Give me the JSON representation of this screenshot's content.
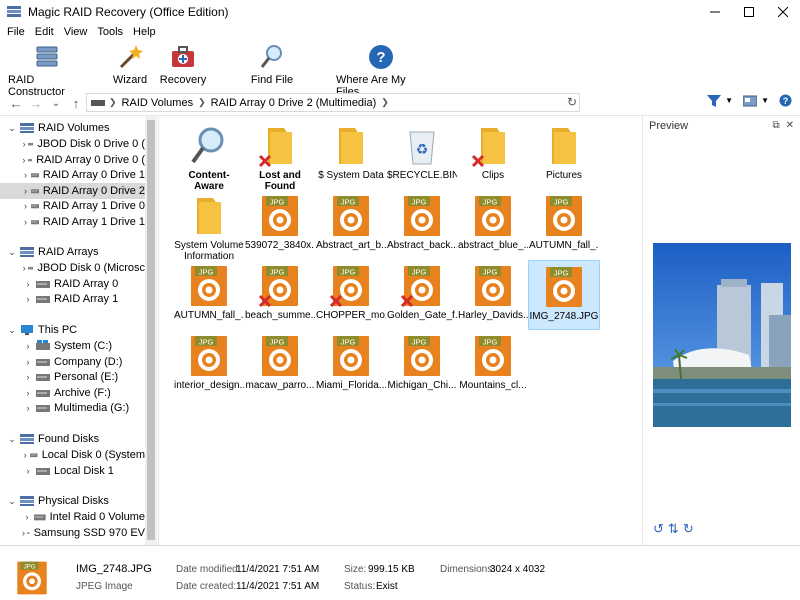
{
  "window": {
    "title": "Magic RAID Recovery (Office Edition)"
  },
  "menu": [
    "File",
    "Edit",
    "View",
    "Tools",
    "Help"
  ],
  "toolbar": {
    "raid_constructor": "RAID Constructor",
    "wizard": "Wizard",
    "recovery": "Recovery",
    "find_file": "Find File",
    "where": "Where Are My Files"
  },
  "address": {
    "crumbs": [
      "RAID Volumes",
      "RAID Array 0 Drive 2 (Multimedia)"
    ]
  },
  "tree": {
    "raid_volumes": {
      "label": "RAID Volumes",
      "items": [
        "JBOD Disk 0 Drive 0 (",
        "RAID Array 0 Drive 0 (",
        "RAID Array 0 Drive 1",
        "RAID Array 0 Drive 2",
        "RAID Array 1 Drive 0",
        "RAID Array 1 Drive 1"
      ]
    },
    "raid_arrays": {
      "label": "RAID Arrays",
      "items": [
        "JBOD Disk 0 (Microsc",
        "RAID Array 0",
        "RAID Array 1"
      ]
    },
    "this_pc": {
      "label": "This PC",
      "items": [
        "System (C:)",
        "Company (D:)",
        "Personal (E:)",
        "Archive (F:)",
        "Multimedia (G:)"
      ]
    },
    "found_disks": {
      "label": "Found Disks",
      "items": [
        "Local Disk 0 (System",
        "Local Disk 1"
      ]
    },
    "physical_disks": {
      "label": "Physical Disks",
      "items": [
        "Intel Raid 0 Volume",
        "Samsung SSD 970 EV"
      ]
    }
  },
  "files": [
    {
      "name": "Content-Aware Analysis",
      "type": "search",
      "bold": true,
      "deleted": false
    },
    {
      "name": "Lost and Found",
      "type": "folder",
      "bold": true,
      "deleted": true
    },
    {
      "name": "$ System Data",
      "type": "folder",
      "bold": false,
      "deleted": false
    },
    {
      "name": "$RECYCLE.BIN",
      "type": "recycle",
      "bold": false,
      "deleted": false
    },
    {
      "name": "Clips",
      "type": "folder",
      "bold": false,
      "deleted": true
    },
    {
      "name": "Pictures",
      "type": "folder",
      "bold": false,
      "deleted": false
    },
    {
      "name": "System Volume Information",
      "type": "folder",
      "bold": false,
      "deleted": false
    },
    {
      "name": "539072_3840x...",
      "type": "jpg",
      "bold": false,
      "deleted": false
    },
    {
      "name": "Abstract_art_b...",
      "type": "jpg",
      "bold": false,
      "deleted": false
    },
    {
      "name": "Abstract_back...",
      "type": "jpg",
      "bold": false,
      "deleted": false
    },
    {
      "name": "abstract_blue_...",
      "type": "jpg",
      "bold": false,
      "deleted": false
    },
    {
      "name": "AUTUMN_fall_...",
      "type": "jpg",
      "bold": false,
      "deleted": false
    },
    {
      "name": "AUTUMN_fall_...",
      "type": "jpg",
      "bold": false,
      "deleted": false
    },
    {
      "name": "beach_summe...",
      "type": "jpg",
      "bold": false,
      "deleted": true
    },
    {
      "name": "CHOPPER_mo...",
      "type": "jpg",
      "bold": false,
      "deleted": true
    },
    {
      "name": "Golden_Gate_f...",
      "type": "jpg",
      "bold": false,
      "deleted": true
    },
    {
      "name": "Harley_Davids...",
      "type": "jpg",
      "bold": false,
      "deleted": false
    },
    {
      "name": "IMG_2748.JPG",
      "type": "jpg",
      "bold": false,
      "deleted": false,
      "selected": true
    },
    {
      "name": "interior_design...",
      "type": "jpg",
      "bold": false,
      "deleted": false
    },
    {
      "name": "macaw_parro...",
      "type": "jpg",
      "bold": false,
      "deleted": false
    },
    {
      "name": "Miami_Florida...",
      "type": "jpg",
      "bold": false,
      "deleted": false
    },
    {
      "name": "Michigan_Chi...",
      "type": "jpg",
      "bold": false,
      "deleted": false
    },
    {
      "name": "Mountains_cl...",
      "type": "jpg",
      "bold": false,
      "deleted": false
    }
  ],
  "jpg_badge": "JPG",
  "preview": {
    "title": "Preview"
  },
  "status": {
    "file_name": "IMG_2748.JPG",
    "file_type": "JPEG Image",
    "modified_label": "Date modified:",
    "modified_value": "11/4/2021 7:51 AM",
    "created_label": "Date created:",
    "created_value": "11/4/2021 7:51 AM",
    "size_label": "Size:",
    "size_value": "999.15 KB",
    "status_label": "Status:",
    "status_value": "Exist",
    "dimensions_label": "Dimensions:",
    "dimensions_value": "3024 x 4032"
  },
  "colors": {
    "folder": "#f5c242",
    "jpg_orange": "#e8821e",
    "jpg_olive": "#8e8c2b",
    "delete_red": "#d42a2a",
    "selected": "#cce8ff"
  }
}
